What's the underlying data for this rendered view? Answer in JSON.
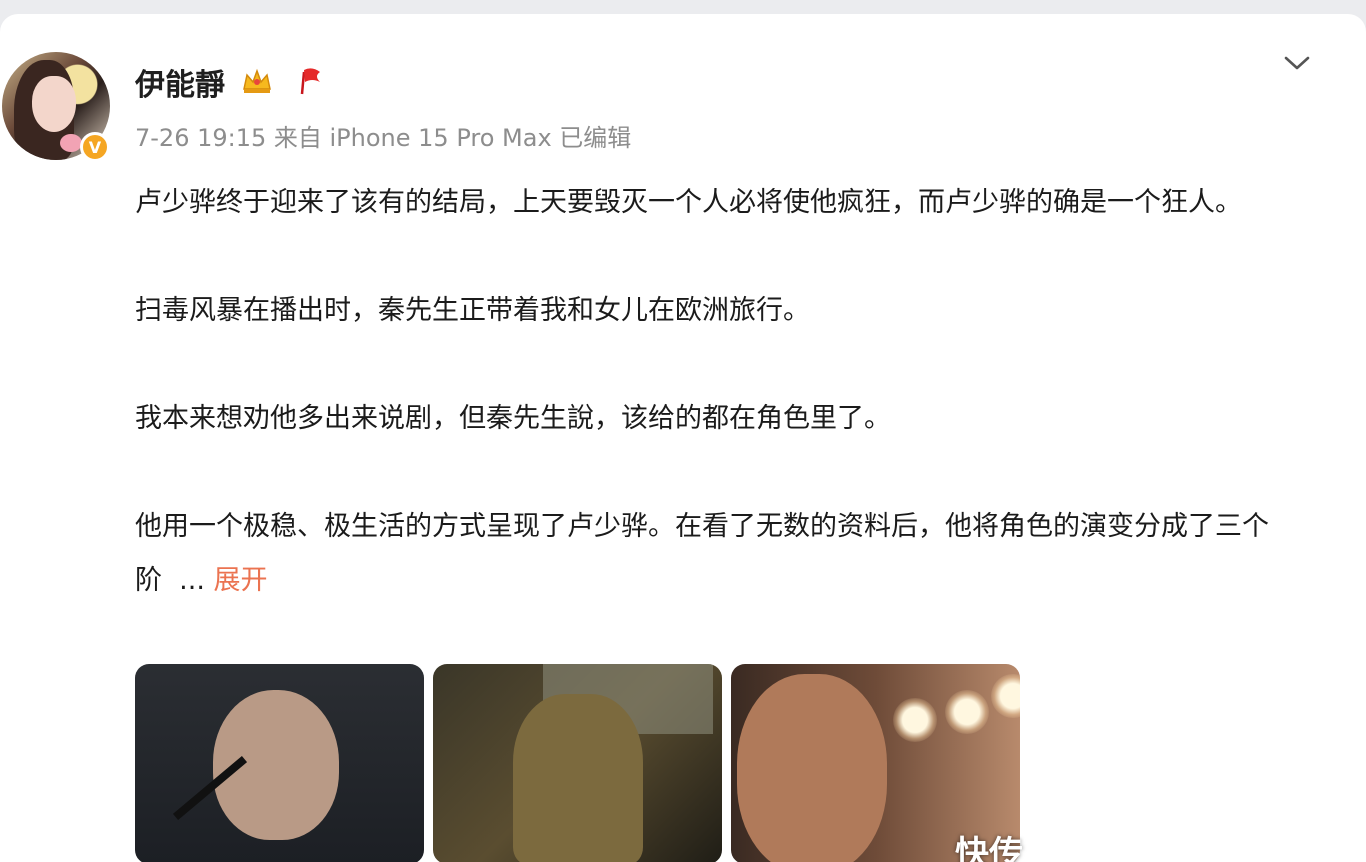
{
  "post": {
    "author": {
      "name": "伊能靜",
      "verified_badge": "V"
    },
    "meta": "7-26 19:15 来自 iPhone 15 Pro Max 已编辑",
    "paragraphs": [
      "卢少骅终于迎来了该有的结局，上天要毁灭一个人必将使他疯狂，而卢少骅的确是一个狂人。",
      "扫毒风暴在播出时，秦先生正带着我和女儿在欧洲旅行。",
      "我本来想劝他多出来说剧，但秦先生說，该给的都在角色里了。",
      "他用一个极稳、极生活的方式呈现了卢少骅。在看了无数的资料后，他将角色的演变分成了三个阶"
    ],
    "ellipsis": "...",
    "expand_label": "展开",
    "icons": {
      "crown": "crown-icon",
      "flag": "flag-icon",
      "menu": "chevron-down-icon"
    },
    "images": [
      {
        "name": "image-thumbnail-1"
      },
      {
        "name": "image-thumbnail-2"
      },
      {
        "name": "image-thumbnail-3"
      }
    ],
    "watermark": "快传"
  },
  "colors": {
    "link": "#eb7350",
    "meta": "#8d8d8d",
    "badge": "#f5a623"
  }
}
